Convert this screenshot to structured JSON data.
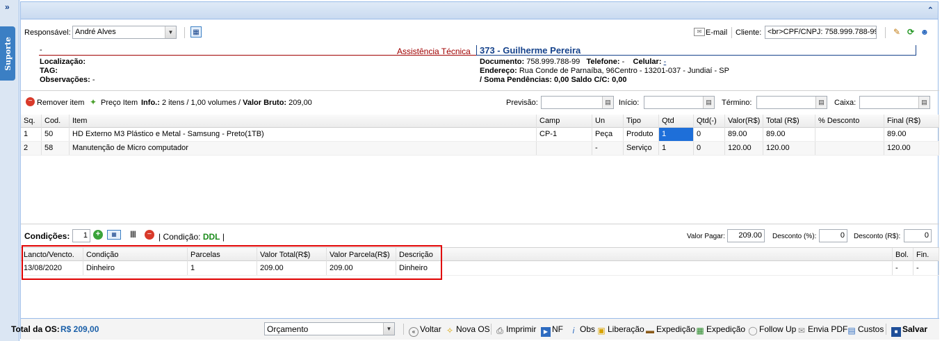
{
  "side": {
    "expand_glyph": "»",
    "suporte_label": "Suporte"
  },
  "title_bar": {
    "collapse_glyph": "⌃"
  },
  "toolbar": {
    "responsavel_label": "Responsável:",
    "responsavel_value": "André Alves",
    "email_label": "E-mail",
    "cliente_label": "Cliente:",
    "cliente_value": "<br>CPF/CNPJ: 758.999.788-99"
  },
  "info": {
    "dash": "-",
    "assistencia": "Assistência Técnica",
    "localizacao_label": "Localização:",
    "tag_label": "TAG:",
    "observacoes_label": "Observações:",
    "observacoes_value": "-",
    "cliente_title": "373 - Guilherme Pereira",
    "documento_label": "Documento:",
    "documento_value": "758.999.788-99",
    "telefone_label": "Telefone:",
    "telefone_value": "-",
    "celular_label": "Celular:",
    "celular_value": "-",
    "endereco_label": "Endereço:",
    "endereco_value": "Rua Conde de Parnaíba, 96Centro - 13201-037 - Jundiaí - SP",
    "pendencias": "/ Soma Pendências: 0,00 Saldo C/C: 0,00"
  },
  "items_toolbar": {
    "remover": "Remover item",
    "preco": "Preço Item",
    "info_label": "Info.:",
    "info_value": "2 itens / 1,00 volumes /",
    "valor_bruto_label": "Valor Bruto:",
    "valor_bruto_value": "209,00",
    "previsao_label": "Previsão:",
    "inicio_label": "Início:",
    "termino_label": "Término:",
    "caixa_label": "Caixa:"
  },
  "grid": {
    "headers": [
      "Sq.",
      "Cod.",
      "Item",
      "Camp",
      "Un",
      "Tipo",
      "Qtd",
      "Qtd(-)",
      "Valor(R$)",
      "Total (R$)",
      "% Desconto",
      "Final (R$)"
    ],
    "rows": [
      [
        "1",
        "50",
        "HD Externo M3 Plástico e Metal - Samsung - Preto(1TB)",
        "CP-1",
        "Peça",
        "Produto",
        "1",
        "0",
        "89.00",
        "89.00",
        "",
        "89.00"
      ],
      [
        "2",
        "58",
        "Manutenção de Micro computador",
        "",
        "-",
        "Serviço",
        "1",
        "0",
        "120.00",
        "120.00",
        "",
        "120.00"
      ]
    ]
  },
  "condicoes": {
    "label": "Condições:",
    "value": "1",
    "condicao_label": "| Condição:",
    "condicao_value": "DDL",
    "condicao_end": "|",
    "valor_pagar_label": "Valor Pagar:",
    "valor_pagar_value": "209.00",
    "desconto_pct_label": "Desconto (%):",
    "desconto_pct_value": "0",
    "desconto_rs_label": "Desconto (R$):",
    "desconto_rs_value": "0"
  },
  "payments": {
    "headers": [
      "Lancto/Vencto.",
      "Condição",
      "Parcelas",
      "Valor Total(R$)",
      "Valor Parcela(R$)",
      "Descrição",
      "Bol.",
      "Fin."
    ],
    "rows": [
      [
        "13/08/2020",
        "Dinheiro",
        "1",
        "209.00",
        "209.00",
        "Dinheiro",
        "-",
        "-"
      ]
    ]
  },
  "footer": {
    "total_label": "Total da OS:",
    "total_value": "R$ 209,00",
    "status_value": "Orçamento",
    "buttons": [
      "Voltar",
      "Nova OS",
      "Imprimir",
      "NF",
      "Obs",
      "Liberação",
      "Expedição",
      "Expedição",
      "Follow Up",
      "Envia PDF",
      "Custos",
      "Salvar"
    ]
  }
}
